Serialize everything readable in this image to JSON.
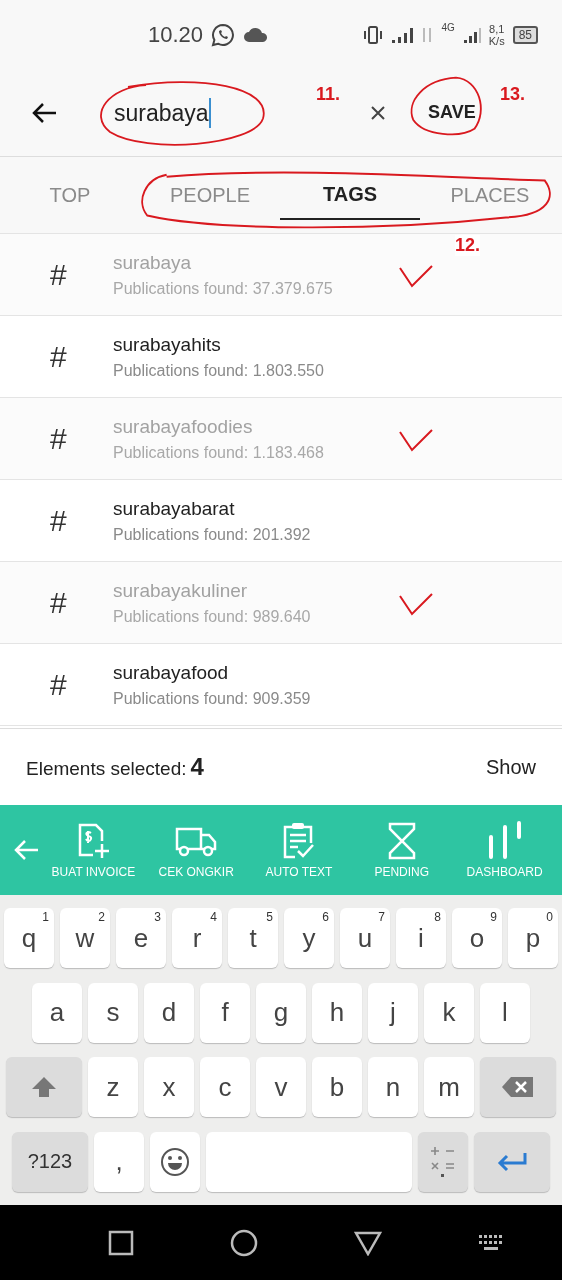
{
  "status_bar": {
    "time": "10.20",
    "network": "4G",
    "speed": "8,1",
    "speed_unit": "K/s",
    "battery": "85"
  },
  "search": {
    "value": "surabaya",
    "save": "SAVE"
  },
  "annotations": [
    "11.",
    "12.",
    "13."
  ],
  "tabs": [
    {
      "label": "TOP",
      "selected": false
    },
    {
      "label": "PEOPLE",
      "selected": false
    },
    {
      "label": "TAGS",
      "selected": true
    },
    {
      "label": "PLACES",
      "selected": false
    }
  ],
  "results": [
    {
      "tag": "surabaya",
      "count": "Publications found: 37.379.675",
      "selected": true
    },
    {
      "tag": "surabayahits",
      "count": "Publications found: 1.803.550",
      "selected": false
    },
    {
      "tag": "surabayafoodies",
      "count": "Publications found: 1.183.468",
      "selected": true
    },
    {
      "tag": "surabayabarat",
      "count": "Publications found: 201.392",
      "selected": false
    },
    {
      "tag": "surabayakuliner",
      "count": "Publications found: 989.640",
      "selected": true
    },
    {
      "tag": "surabayafood",
      "count": "Publications found: 909.359",
      "selected": false
    }
  ],
  "hash": "#",
  "selection": {
    "label": "Elements selected:",
    "count": "4",
    "action": "Show"
  },
  "toolbar": [
    {
      "kind": "invoice",
      "label": "BUAT INVOICE"
    },
    {
      "kind": "truck",
      "label": "CEK ONGKIR"
    },
    {
      "kind": "clipboard",
      "label": "AUTO TEXT"
    },
    {
      "kind": "hourglass",
      "label": "PENDING"
    },
    {
      "kind": "bars",
      "label": "DASHBOARD"
    }
  ],
  "keyboard": {
    "row1": [
      {
        "key": "q",
        "hint": "1"
      },
      {
        "key": "w",
        "hint": "2"
      },
      {
        "key": "e",
        "hint": "3"
      },
      {
        "key": "r",
        "hint": "4"
      },
      {
        "key": "t",
        "hint": "5"
      },
      {
        "key": "y",
        "hint": "6"
      },
      {
        "key": "u",
        "hint": "7"
      },
      {
        "key": "i",
        "hint": "8"
      },
      {
        "key": "o",
        "hint": "9"
      },
      {
        "key": "p",
        "hint": "0"
      }
    ],
    "row2": [
      "a",
      "s",
      "d",
      "f",
      "g",
      "h",
      "j",
      "k",
      "l"
    ],
    "row3": [
      "z",
      "x",
      "c",
      "v",
      "b",
      "n",
      "m"
    ],
    "symbols": "?123",
    "comma": ","
  }
}
